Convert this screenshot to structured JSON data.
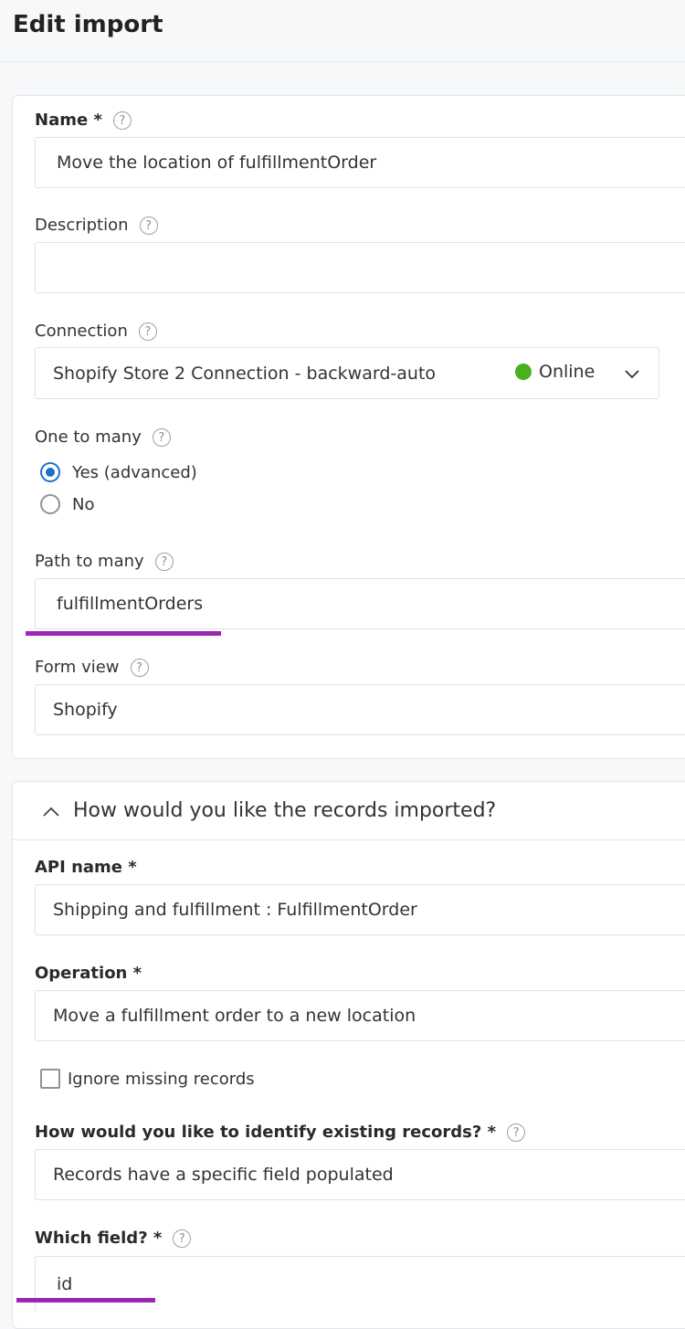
{
  "header": {
    "title": "Edit import"
  },
  "general": {
    "name": {
      "label": "Name *",
      "value": "Move the location of fulfillmentOrder"
    },
    "description": {
      "label": "Description",
      "value": ""
    },
    "connection": {
      "label": "Connection",
      "value": "Shopify Store 2 Connection - backward-auto",
      "status": "Online",
      "status_color": "#4caf1e"
    },
    "one_to_many": {
      "label": "One to many",
      "options": [
        "Yes (advanced)",
        "No"
      ],
      "selected": "Yes (advanced)"
    },
    "path_to_many": {
      "label": "Path to many",
      "value": "fulfillmentOrders"
    },
    "form_view": {
      "label": "Form view",
      "value": "Shopify"
    }
  },
  "records_section": {
    "title": "How would you like the records imported?",
    "api_name": {
      "label": "API name *",
      "value": "Shipping and fulfillment : FulfillmentOrder"
    },
    "operation": {
      "label": "Operation *",
      "value": "Move a fulfillment order to a new location"
    },
    "ignore_missing": {
      "label": "Ignore missing records",
      "checked": false
    },
    "identify": {
      "label": "How would you like to identify existing records? *",
      "value": "Records have a specific field populated"
    },
    "which_field": {
      "label": "Which field? *",
      "value": "id"
    }
  },
  "help_icon_glyph": "?",
  "annotation_color": "#9c27b0",
  "accent_color": "#1d6fce"
}
